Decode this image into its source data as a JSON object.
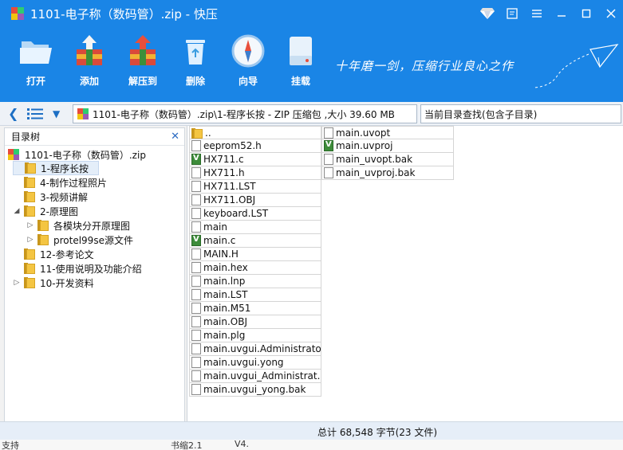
{
  "window": {
    "title": "1101-电子称（数码管）.zip - 快压"
  },
  "toolbar": {
    "buttons": [
      {
        "id": "open",
        "label": "打开",
        "icon": "folder-open-icon"
      },
      {
        "id": "add",
        "label": "添加",
        "icon": "add-archive-icon"
      },
      {
        "id": "extract",
        "label": "解压到",
        "icon": "extract-archive-icon"
      },
      {
        "id": "delete",
        "label": "删除",
        "icon": "trash-icon"
      },
      {
        "id": "wizard",
        "label": "向导",
        "icon": "compass-icon"
      },
      {
        "id": "mount",
        "label": "挂载",
        "icon": "drive-icon"
      }
    ],
    "slogan": "十年磨一剑，压缩行业良心之作"
  },
  "address": {
    "path": "1101-电子称（数码管）.zip\\1-程序长按 - ZIP 压缩包 ,大小 39.60 MB",
    "search_placeholder": "当前目录查找(包含子目录)"
  },
  "tree": {
    "header": "目录树",
    "root": "1101-电子称（数码管）.zip",
    "items": [
      {
        "label": "1-程序长按",
        "level": 1,
        "arrow": "",
        "selected": true
      },
      {
        "label": "4-制作过程照片",
        "level": 1,
        "arrow": ""
      },
      {
        "label": "3-视频讲解",
        "level": 1,
        "arrow": ""
      },
      {
        "label": "2-原理图",
        "level": 1,
        "arrow": "◢"
      },
      {
        "label": "各模块分开原理图",
        "level": 2,
        "arrow": "▷"
      },
      {
        "label": "protel99se源文件",
        "level": 2,
        "arrow": "▷"
      },
      {
        "label": "12-参考论文",
        "level": 1,
        "arrow": ""
      },
      {
        "label": "11-使用说明及功能介绍",
        "level": 1,
        "arrow": ""
      },
      {
        "label": "10-开发资料",
        "level": 1,
        "arrow": "▷"
      }
    ]
  },
  "files": {
    "column1": [
      {
        "name": "..",
        "type": "folder"
      },
      {
        "name": "eeprom52.h",
        "type": "doc"
      },
      {
        "name": "HX711.c",
        "type": "vs"
      },
      {
        "name": "HX711.h",
        "type": "doc"
      },
      {
        "name": "HX711.LST",
        "type": "doc"
      },
      {
        "name": "HX711.OBJ",
        "type": "doc"
      },
      {
        "name": "keyboard.LST",
        "type": "doc"
      },
      {
        "name": "main",
        "type": "doc"
      },
      {
        "name": "main.c",
        "type": "vs"
      },
      {
        "name": "MAIN.H",
        "type": "doc"
      },
      {
        "name": "main.hex",
        "type": "doc"
      },
      {
        "name": "main.lnp",
        "type": "doc"
      },
      {
        "name": "main.LST",
        "type": "doc"
      },
      {
        "name": "main.M51",
        "type": "doc"
      },
      {
        "name": "main.OBJ",
        "type": "doc"
      },
      {
        "name": "main.plg",
        "type": "doc"
      },
      {
        "name": "main.uvgui.Administrator",
        "type": "doc"
      },
      {
        "name": "main.uvgui.yong",
        "type": "doc"
      },
      {
        "name": "main.uvgui_Administrat...",
        "type": "doc"
      },
      {
        "name": "main.uvgui_yong.bak",
        "type": "doc"
      }
    ],
    "column2": [
      {
        "name": "main.uvopt",
        "type": "doc"
      },
      {
        "name": "main.uvproj",
        "type": "vs"
      },
      {
        "name": "main_uvopt.bak",
        "type": "doc"
      },
      {
        "name": "main_uvproj.bak",
        "type": "doc"
      }
    ]
  },
  "status": {
    "summary": "总计  68,548 字节(23 文件)"
  },
  "taskbar": {
    "left": "支持",
    "mid": "书缩2.1",
    "right": "V4."
  },
  "colors": {
    "titlebar": "#1a85e6",
    "accent": "#1d6fc4",
    "folder": "#f4c542"
  }
}
